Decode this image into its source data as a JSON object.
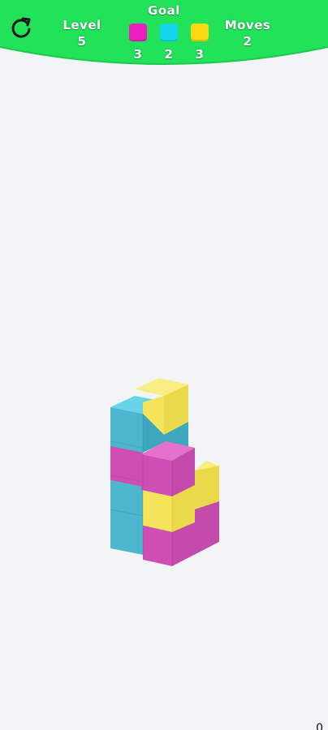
{
  "hud": {
    "level_label": "Level",
    "level_value": "5",
    "goal_label": "Goal",
    "moves_label": "Moves",
    "moves_value": "2",
    "restart_icon": "restart-icon",
    "goals": [
      {
        "color": "#ee1fbf",
        "count": "3"
      },
      {
        "color": "#13d6ee",
        "count": "2"
      },
      {
        "color": "#f9d90f",
        "count": "3"
      }
    ]
  },
  "colors": {
    "hud_green": "#22e25a",
    "magenta": "#d85bbf",
    "cyan": "#53c1d6",
    "yellow": "#f3e45a"
  },
  "footer": {
    "corner_text": "0"
  }
}
